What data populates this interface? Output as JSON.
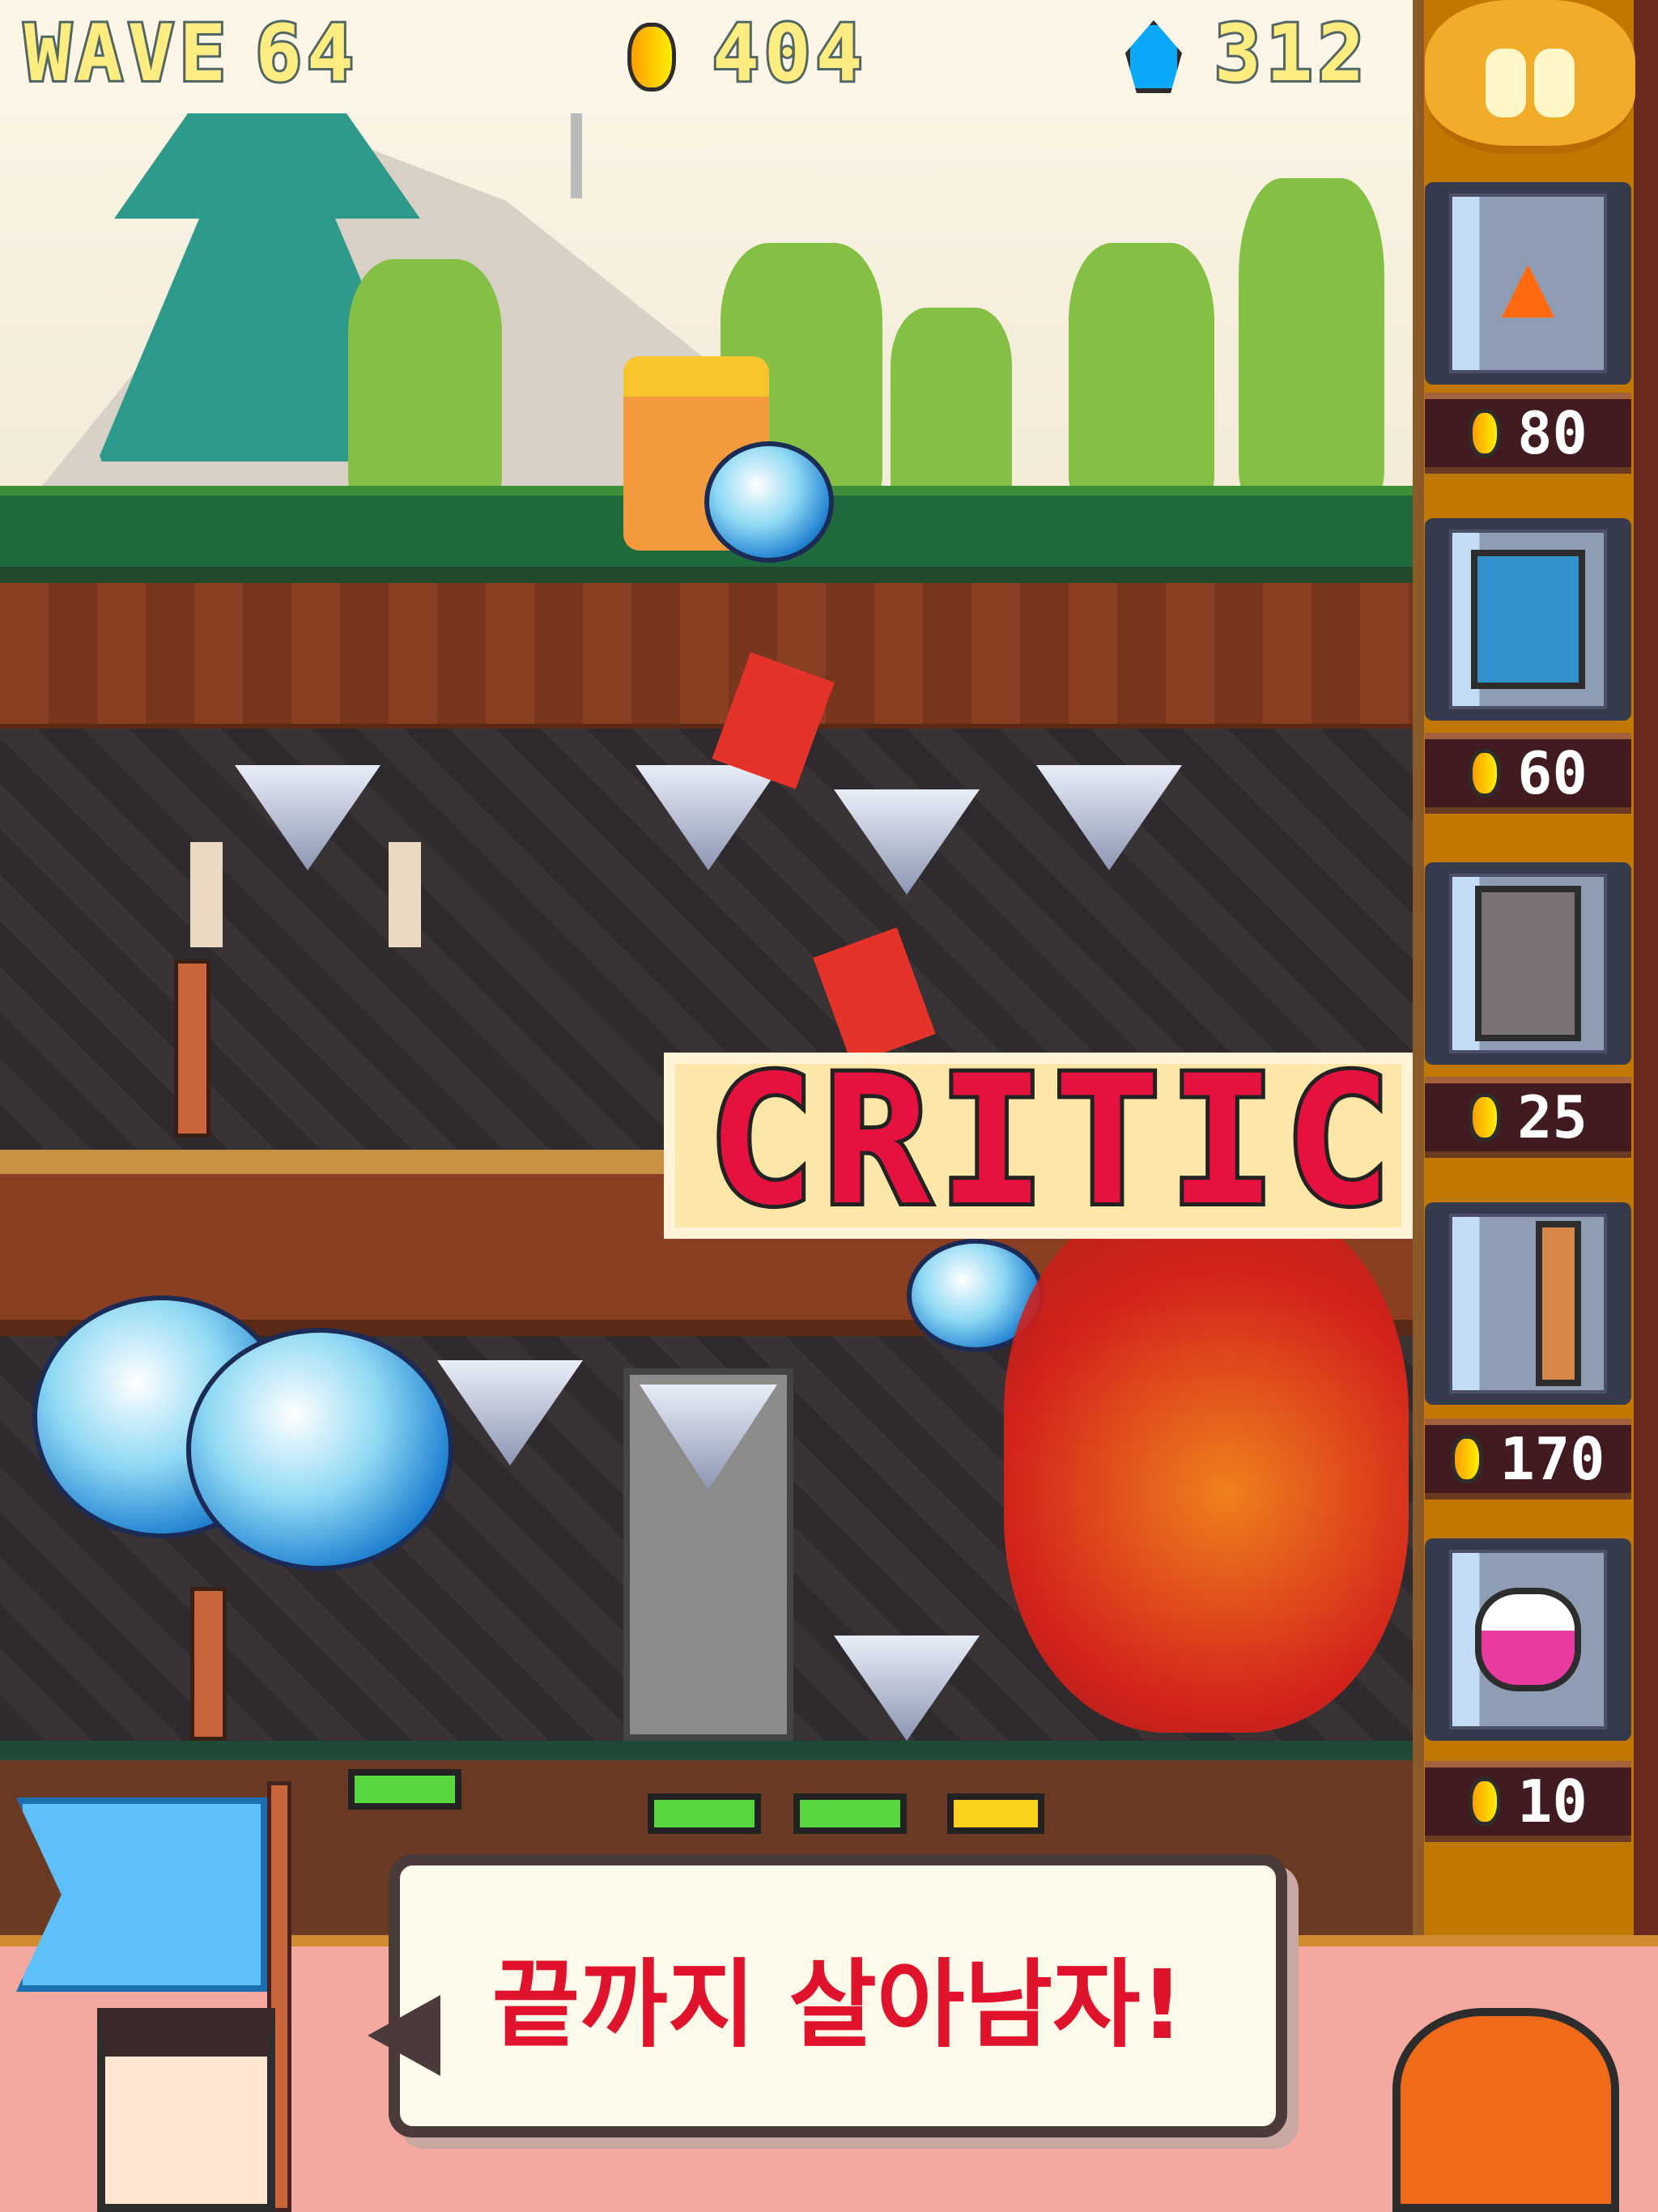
{
  "hud": {
    "wave_label": "WAVE",
    "wave_number": "64",
    "gold_icon": "coin-icon",
    "gold": "404",
    "gem_icon": "blue-gem-icon",
    "gems": "312",
    "pause_icon": "pause-icon"
  },
  "shop": [
    {
      "item": "campfire-trap",
      "icon": "fire-icon",
      "price": "80"
    },
    {
      "item": "ice-block",
      "icon": "ice-icon",
      "price": "60"
    },
    {
      "item": "stone-wall",
      "icon": "stone-icon",
      "price": "25"
    },
    {
      "item": "arrow-trap",
      "icon": "arrow-trap-icon",
      "price": "170"
    },
    {
      "item": "pink-potion",
      "icon": "potion-icon",
      "price": "10"
    }
  ],
  "battle": {
    "critical_text": "CRITIC"
  },
  "banner": {
    "message": "끝까지 살아남자!"
  },
  "colors": {
    "hud_text": "#fdec80",
    "critical_text": "#e6113f",
    "banner_text": "#e0122c",
    "sidebar": "#c07800"
  }
}
